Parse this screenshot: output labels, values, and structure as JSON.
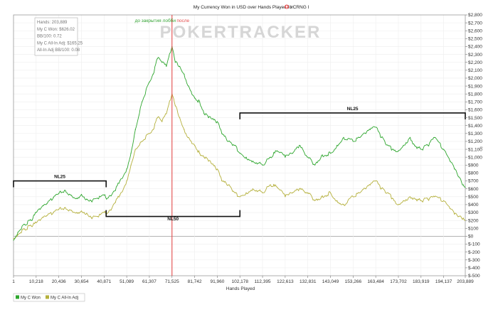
{
  "chart_data": {
    "type": "line",
    "title": "My Currency Won in USD over Hands Played for",
    "title_suffix": "I CRNG I",
    "xlabel": "Hands Played",
    "ylabel": "",
    "xlim": [
      1,
      203889
    ],
    "ylim": [
      -500,
      2800
    ],
    "x_ticks": [
      1,
      10218,
      20436,
      30654,
      40871,
      51089,
      61307,
      71525,
      81742,
      91960,
      102178,
      112395,
      122613,
      132831,
      143049,
      153266,
      163484,
      173702,
      183919,
      194137,
      203889
    ],
    "x_tick_labels": [
      "1",
      "10,218",
      "20,436",
      "30,654",
      "40,871",
      "51,089",
      "61,307",
      "71,525",
      "81,742",
      "91,960",
      "102,178",
      "112,395",
      "122,613",
      "132,831",
      "143,049",
      "153,266",
      "163,484",
      "173,702",
      "183,919",
      "194,137",
      "203,889"
    ],
    "y_ticks": [
      2800,
      2700,
      2600,
      2500,
      2400,
      2300,
      2200,
      2100,
      2000,
      1900,
      1800,
      1700,
      1600,
      1500,
      1400,
      1300,
      1200,
      1100,
      1000,
      900,
      800,
      700,
      600,
      500,
      400,
      300,
      200,
      100,
      0,
      -100,
      -200,
      -300,
      -400,
      -500
    ],
    "y_tick_labels": [
      "$2,800",
      "$2,700",
      "$2,600",
      "$2,500",
      "$2,400",
      "$2,300",
      "$2,200",
      "$2,100",
      "$2,000",
      "$1,900",
      "$1,800",
      "$1,700",
      "$1,600",
      "$1,500",
      "$1,400",
      "$1,300",
      "$1,200",
      "$1,100",
      "$1,000",
      "$900",
      "$800",
      "$700",
      "$600",
      "$500",
      "$400",
      "$300",
      "$200",
      "$100",
      "$0",
      "$-100",
      "$-200",
      "$-300",
      "$-400",
      "$-500"
    ],
    "grid": true,
    "legend_position": "bottom-left",
    "stats": [
      "Hands: 203,889",
      "My C Won: $626.02",
      "BB/100: 0.72",
      "My C All-In Adj: $165.25",
      "All-In Adj BB/100: 0.08"
    ],
    "watermark": "POKERTRACKER",
    "series": [
      {
        "name": "My C Won",
        "color": "#2ea62e",
        "x": [
          1,
          2000,
          5000,
          8000,
          10218,
          12000,
          15000,
          18000,
          20436,
          23000,
          26000,
          28500,
          30654,
          33000,
          35000,
          38000,
          40871,
          42000,
          44000,
          46000,
          48000,
          51089,
          53000,
          55000,
          58000,
          61307,
          63000,
          65000,
          67000,
          69000,
          71525,
          73000,
          75000,
          77000,
          79000,
          81742,
          84000,
          86000,
          88000,
          91960,
          94000,
          97000,
          100000,
          102178,
          105000,
          108000,
          112395,
          116000,
          119000,
          122613,
          126000,
          129000,
          132831,
          136000,
          139000,
          143049,
          146000,
          149000,
          153266,
          156000,
          159000,
          161000,
          163484,
          166000,
          169000,
          171000,
          173702,
          176000,
          179000,
          181000,
          183919,
          187000,
          190000,
          194137,
          197000,
          199000,
          201000,
          203000,
          203889
        ],
        "y": [
          -50,
          50,
          150,
          200,
          300,
          340,
          410,
          490,
          540,
          580,
          520,
          480,
          530,
          470,
          450,
          480,
          520,
          470,
          510,
          580,
          700,
          850,
          1050,
          1350,
          1700,
          1950,
          2050,
          2250,
          2200,
          2150,
          2400,
          2200,
          2150,
          2050,
          1900,
          1750,
          1700,
          1550,
          1500,
          1450,
          1300,
          1200,
          1150,
          1050,
          1000,
          950,
          900,
          1000,
          1080,
          1000,
          1050,
          1150,
          1000,
          900,
          1020,
          1050,
          1150,
          1250,
          1200,
          1250,
          1300,
          1350,
          1380,
          1250,
          1150,
          1100,
          1080,
          1150,
          1250,
          1150,
          1100,
          1150,
          1250,
          1100,
          950,
          850,
          750,
          650,
          620
        ]
      },
      {
        "name": "My C All-In Adj",
        "color": "#b5b03c",
        "x": [
          1,
          2000,
          5000,
          8000,
          10218,
          12000,
          15000,
          18000,
          20436,
          23000,
          26000,
          28500,
          30654,
          33000,
          35000,
          38000,
          40871,
          42000,
          44000,
          46000,
          48000,
          51089,
          53000,
          55000,
          58000,
          61307,
          63000,
          65000,
          67000,
          69000,
          71525,
          73000,
          75000,
          77000,
          79000,
          81742,
          84000,
          86000,
          88000,
          91960,
          94000,
          97000,
          100000,
          102178,
          105000,
          108000,
          112395,
          116000,
          119000,
          122613,
          126000,
          129000,
          132831,
          136000,
          139000,
          143049,
          146000,
          149000,
          153266,
          156000,
          159000,
          161000,
          163484,
          166000,
          169000,
          171000,
          173702,
          176000,
          179000,
          181000,
          183919,
          187000,
          190000,
          194137,
          197000,
          199000,
          201000,
          203000,
          203889
        ],
        "y": [
          -30,
          20,
          90,
          130,
          170,
          200,
          260,
          300,
          340,
          360,
          330,
          300,
          320,
          290,
          240,
          250,
          300,
          280,
          330,
          430,
          520,
          700,
          900,
          1100,
          1200,
          1300,
          1350,
          1500,
          1450,
          1550,
          1800,
          1650,
          1500,
          1350,
          1250,
          1150,
          1050,
          1000,
          950,
          850,
          700,
          650,
          550,
          500,
          550,
          600,
          550,
          650,
          620,
          500,
          550,
          600,
          550,
          450,
          500,
          550,
          450,
          400,
          500,
          550,
          600,
          650,
          700,
          600,
          550,
          480,
          400,
          450,
          500,
          480,
          450,
          470,
          500,
          450,
          350,
          280,
          250,
          230,
          200
        ]
      }
    ],
    "annotations": [
      {
        "type": "vline",
        "x": 71525,
        "color": "#e34b4b"
      },
      {
        "type": "text",
        "text": "до закрытия лобби",
        "x": 64000,
        "y": 2710,
        "color": "#33a333"
      },
      {
        "type": "text",
        "text": "после",
        "x": 76500,
        "y": 2710,
        "color": "#e34b4b"
      },
      {
        "type": "bracket",
        "label": "NL25",
        "x0": 1,
        "x1": 41800,
        "y": 700,
        "dir": "down",
        "label_y": 735
      },
      {
        "type": "bracket",
        "label": "NL50",
        "x0": 41800,
        "x1": 102178,
        "y": 250,
        "dir": "up",
        "label_y": 200
      },
      {
        "type": "bracket",
        "label": "NL25",
        "x0": 102178,
        "x1": 203889,
        "y": 1560,
        "dir": "down",
        "label_y": 1595
      }
    ]
  }
}
